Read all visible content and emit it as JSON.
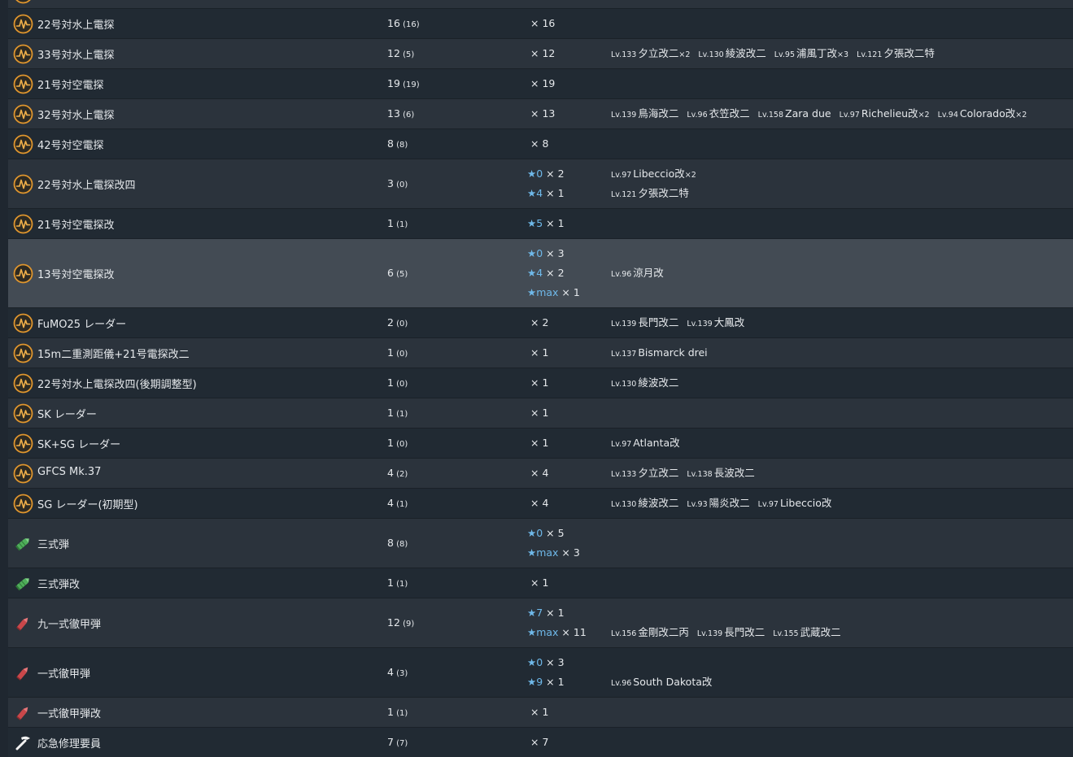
{
  "rows": [
    {
      "icon": "radar",
      "name": "",
      "count": "",
      "avail": "",
      "imp": [],
      "ships": []
    },
    {
      "icon": "radar",
      "name": "22号対水上電探",
      "count": "16",
      "avail": "(16)",
      "imp": [
        {
          "star": "",
          "mult": "× 16"
        }
      ],
      "ships": []
    },
    {
      "icon": "radar",
      "name": "33号対水上電探",
      "count": "12",
      "avail": "(5)",
      "imp": [
        {
          "star": "",
          "mult": "× 12"
        }
      ],
      "ships": [
        [
          {
            "lv": "Lv.133",
            "name": "夕立改二",
            "mul": "×2"
          },
          {
            "lv": "Lv.130",
            "name": "綾波改二",
            "mul": ""
          },
          {
            "lv": "Lv.95",
            "name": "浦風丁改",
            "mul": "×3"
          },
          {
            "lv": "Lv.121",
            "name": "夕張改二特",
            "mul": ""
          }
        ]
      ]
    },
    {
      "icon": "radar",
      "name": "21号対空電探",
      "count": "19",
      "avail": "(19)",
      "imp": [
        {
          "star": "",
          "mult": "× 19"
        }
      ],
      "ships": []
    },
    {
      "icon": "radar",
      "name": "32号対水上電探",
      "count": "13",
      "avail": "(6)",
      "imp": [
        {
          "star": "",
          "mult": "× 13"
        }
      ],
      "ships": [
        [
          {
            "lv": "Lv.139",
            "name": "鳥海改二",
            "mul": ""
          },
          {
            "lv": "Lv.96",
            "name": "衣笠改二",
            "mul": ""
          },
          {
            "lv": "Lv.158",
            "name": "Zara due",
            "mul": ""
          },
          {
            "lv": "Lv.97",
            "name": "Richelieu改",
            "mul": "×2"
          },
          {
            "lv": "Lv.94",
            "name": "Colorado改",
            "mul": "×2"
          }
        ]
      ]
    },
    {
      "icon": "radar",
      "name": "42号対空電探",
      "count": "8",
      "avail": "(8)",
      "imp": [
        {
          "star": "",
          "mult": "× 8"
        }
      ],
      "ships": []
    },
    {
      "icon": "radar",
      "name": "22号対水上電探改四",
      "count": "3",
      "avail": "(0)",
      "imp": [
        {
          "star": "★0",
          "mult": "× 2"
        },
        {
          "star": "★4",
          "mult": "× 1"
        }
      ],
      "ships": [
        [
          {
            "lv": "Lv.97",
            "name": "Libeccio改",
            "mul": "×2"
          }
        ],
        [
          {
            "lv": "Lv.121",
            "name": "夕張改二特",
            "mul": ""
          }
        ]
      ]
    },
    {
      "icon": "radar",
      "name": "21号対空電探改",
      "count": "1",
      "avail": "(1)",
      "imp": [
        {
          "star": "★5",
          "mult": "× 1"
        }
      ],
      "ships": []
    },
    {
      "icon": "radar",
      "name": "13号対空電探改",
      "count": "6",
      "avail": "(5)",
      "imp": [
        {
          "star": "★0",
          "mult": "× 3"
        },
        {
          "star": "★4",
          "mult": "× 2"
        },
        {
          "star": "★max",
          "mult": "× 1"
        }
      ],
      "ships": [
        [],
        [
          {
            "lv": "Lv.96",
            "name": "涼月改",
            "mul": ""
          }
        ],
        []
      ],
      "highlight": true
    },
    {
      "icon": "radar",
      "name": "FuMO25 レーダー",
      "count": "2",
      "avail": "(0)",
      "imp": [
        {
          "star": "",
          "mult": "× 2"
        }
      ],
      "ships": [
        [
          {
            "lv": "Lv.139",
            "name": "長門改二",
            "mul": ""
          },
          {
            "lv": "Lv.139",
            "name": "大鳳改",
            "mul": ""
          }
        ]
      ]
    },
    {
      "icon": "radar",
      "name": "15m二重測距儀+21号電探改二",
      "count": "1",
      "avail": "(0)",
      "imp": [
        {
          "star": "",
          "mult": "× 1"
        }
      ],
      "ships": [
        [
          {
            "lv": "Lv.137",
            "name": "Bismarck drei",
            "mul": ""
          }
        ]
      ]
    },
    {
      "icon": "radar",
      "name": "22号対水上電探改四(後期調整型)",
      "count": "1",
      "avail": "(0)",
      "imp": [
        {
          "star": "",
          "mult": "× 1"
        }
      ],
      "ships": [
        [
          {
            "lv": "Lv.130",
            "name": "綾波改二",
            "mul": ""
          }
        ]
      ]
    },
    {
      "icon": "radar",
      "name": "SK レーダー",
      "count": "1",
      "avail": "(1)",
      "imp": [
        {
          "star": "",
          "mult": "× 1"
        }
      ],
      "ships": []
    },
    {
      "icon": "radar",
      "name": "SK+SG レーダー",
      "count": "1",
      "avail": "(0)",
      "imp": [
        {
          "star": "",
          "mult": "× 1"
        }
      ],
      "ships": [
        [
          {
            "lv": "Lv.97",
            "name": "Atlanta改",
            "mul": ""
          }
        ]
      ]
    },
    {
      "icon": "radar",
      "name": "GFCS Mk.37",
      "count": "4",
      "avail": "(2)",
      "imp": [
        {
          "star": "",
          "mult": "× 4"
        }
      ],
      "ships": [
        [
          {
            "lv": "Lv.133",
            "name": "夕立改二",
            "mul": ""
          },
          {
            "lv": "Lv.138",
            "name": "長波改二",
            "mul": ""
          }
        ]
      ]
    },
    {
      "icon": "radar",
      "name": "SG レーダー(初期型)",
      "count": "4",
      "avail": "(1)",
      "imp": [
        {
          "star": "",
          "mult": "× 4"
        }
      ],
      "ships": [
        [
          {
            "lv": "Lv.130",
            "name": "綾波改二",
            "mul": ""
          },
          {
            "lv": "Lv.93",
            "name": "陽炎改二",
            "mul": ""
          },
          {
            "lv": "Lv.97",
            "name": "Libeccio改",
            "mul": ""
          }
        ]
      ]
    },
    {
      "icon": "shell-green",
      "name": "三式弾",
      "count": "8",
      "avail": "(8)",
      "imp": [
        {
          "star": "★0",
          "mult": "× 5"
        },
        {
          "star": "★max",
          "mult": "× 3"
        }
      ],
      "ships": []
    },
    {
      "icon": "shell-green",
      "name": "三式弾改",
      "count": "1",
      "avail": "(1)",
      "imp": [
        {
          "star": "",
          "mult": "× 1"
        }
      ],
      "ships": []
    },
    {
      "icon": "shell-red",
      "name": "九一式徹甲弾",
      "count": "12",
      "avail": "(9)",
      "imp": [
        {
          "star": "★7",
          "mult": "× 1"
        },
        {
          "star": "★max",
          "mult": "× 11"
        }
      ],
      "ships": [
        [],
        [
          {
            "lv": "Lv.156",
            "name": "金剛改二丙",
            "mul": ""
          },
          {
            "lv": "Lv.139",
            "name": "長門改二",
            "mul": ""
          },
          {
            "lv": "Lv.155",
            "name": "武蔵改二",
            "mul": ""
          }
        ]
      ]
    },
    {
      "icon": "shell-red",
      "name": "一式徹甲弾",
      "count": "4",
      "avail": "(3)",
      "imp": [
        {
          "star": "★0",
          "mult": "× 3"
        },
        {
          "star": "★9",
          "mult": "× 1"
        }
      ],
      "ships": [
        [],
        [
          {
            "lv": "Lv.96",
            "name": "South Dakota改",
            "mul": ""
          }
        ]
      ]
    },
    {
      "icon": "shell-red",
      "name": "一式徹甲弾改",
      "count": "1",
      "avail": "(1)",
      "imp": [
        {
          "star": "",
          "mult": "× 1"
        }
      ],
      "ships": []
    },
    {
      "icon": "repair",
      "name": "応急修理要員",
      "count": "7",
      "avail": "(7)",
      "imp": [
        {
          "star": "",
          "mult": "× 7"
        }
      ],
      "ships": []
    }
  ]
}
